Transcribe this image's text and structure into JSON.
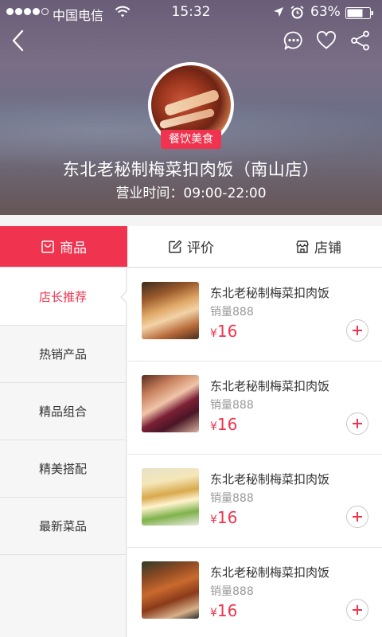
{
  "status_bar": {
    "carrier": "中国电信",
    "time": "15:32",
    "battery": "63%"
  },
  "header": {
    "category_badge": "餐饮美食",
    "store_name": "东北老秘制梅菜扣肉饭（南山店）",
    "business_hours": "营业时间：09:00-22:00"
  },
  "tabs": [
    {
      "label": "商品",
      "icon": "bag-icon",
      "active": true
    },
    {
      "label": "评价",
      "icon": "edit-icon",
      "active": false
    },
    {
      "label": "店铺",
      "icon": "store-icon",
      "active": false
    }
  ],
  "sidebar": {
    "items": [
      {
        "label": "店长推荐",
        "active": true
      },
      {
        "label": "热销产品",
        "active": false
      },
      {
        "label": "精品组合",
        "active": false
      },
      {
        "label": "精美搭配",
        "active": false
      },
      {
        "label": "最新菜品",
        "active": false
      }
    ]
  },
  "products": [
    {
      "name": "东北老秘制梅菜扣肉饭",
      "sales": "销量888",
      "currency": "¥",
      "price": "16"
    },
    {
      "name": "东北老秘制梅菜扣肉饭",
      "sales": "销量888",
      "currency": "¥",
      "price": "16"
    },
    {
      "name": "东北老秘制梅菜扣肉饭",
      "sales": "销量888",
      "currency": "¥",
      "price": "16"
    },
    {
      "name": "东北老秘制梅菜扣肉饭",
      "sales": "销量888",
      "currency": "¥",
      "price": "16"
    }
  ],
  "colors": {
    "accent": "#f0334e",
    "muted_text": "#999999",
    "divider": "#e2e2e2"
  }
}
